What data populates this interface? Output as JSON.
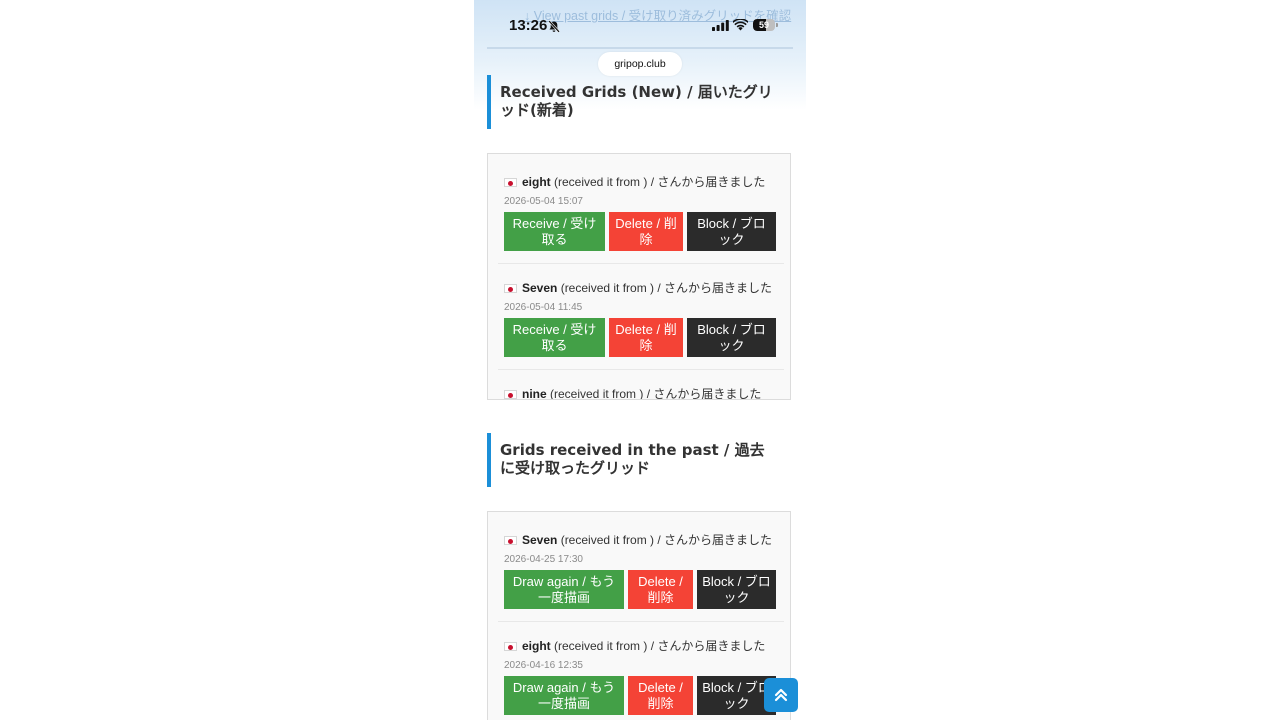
{
  "status": {
    "time": "13:26",
    "battery": "59",
    "battery_level": 0.59
  },
  "browser": {
    "url": "gripop.club"
  },
  "top_link": "↓ View past grids / 受け取り済みグリッドを確認",
  "sections": [
    {
      "title": "Received Grids (New) / 届いたグリッド(新着)",
      "items": [
        {
          "name": "eight",
          "text": " (received it from ) / さんから届きました",
          "date": "2026-05-04 15:07",
          "primary": "Receive / 受け取る",
          "delete": "Delete / 削除",
          "block": "Block / ブロック"
        },
        {
          "name": "Seven",
          "text": " (received it from ) / さんから届きました",
          "date": "2026-05-04 11:45",
          "primary": "Receive / 受け取る",
          "delete": "Delete / 削除",
          "block": "Block / ブロック"
        },
        {
          "name": "nine",
          "text": " (received it from ) / さんから届きました"
        }
      ]
    },
    {
      "title": "Grids received in the past / 過去に受け取ったグリッド",
      "items": [
        {
          "name": "Seven",
          "text": " (received it from ) / さんから届きました",
          "date": "2026-04-25 17:30",
          "primary": "Draw again / もう一度描画",
          "delete": "Delete / 削除",
          "block": "Block / ブロック"
        },
        {
          "name": "eight",
          "text": " (received it from ) / さんから届きました",
          "date": "2026-04-16 12:35",
          "primary": "Draw again / もう一度描画",
          "delete": "Delete / 削除",
          "block": "Block / ブロック"
        }
      ]
    }
  ],
  "colors": {
    "accent": "#1b8fd8",
    "receive": "#43a047",
    "delete": "#f44336",
    "block": "#2b2b2b"
  }
}
